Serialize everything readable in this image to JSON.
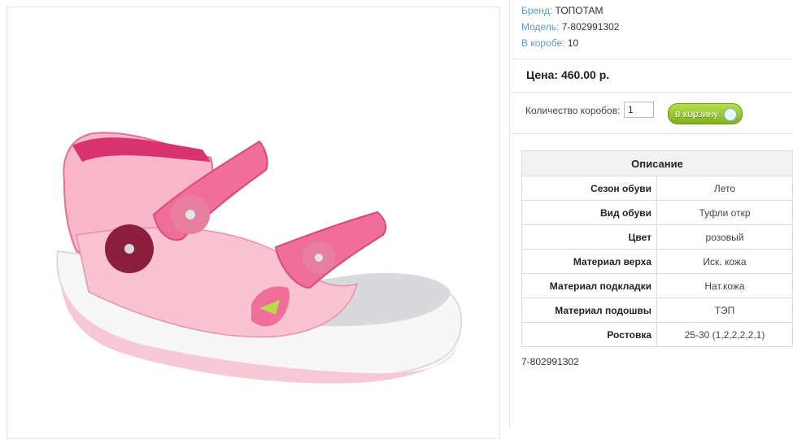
{
  "product": {
    "brand_label": "Бренд:",
    "brand": "ТОПОТАМ",
    "model_label": "Модель:",
    "model": "7-802991302",
    "box_label": "В коробе:",
    "box": "10"
  },
  "price": "Цена: 460.00 р.",
  "order": {
    "qty_label": "Количество коробов:",
    "qty_value": "1",
    "cart_label": "в корзину"
  },
  "description": {
    "header": "Описание",
    "rows": [
      {
        "key": "Сезон обуви",
        "value": "Лето"
      },
      {
        "key": "Вид обуви",
        "value": "Туфли откр"
      },
      {
        "key": "Цвет",
        "value": "розовый"
      },
      {
        "key": "Материал верха",
        "value": "Иск. кожа"
      },
      {
        "key": "Материал подкладки",
        "value": "Нат.кожа"
      },
      {
        "key": "Материал подошвы",
        "value": "ТЭП"
      },
      {
        "key": "Ростовка",
        "value": "25-30 (1,2,2,2,2,1)"
      }
    ]
  },
  "footer_sku": "7-802991302",
  "colors": {
    "link_blue": "#5b9bd1",
    "button_green": "#8cc63f",
    "sandal_pink": "#f06e9a"
  }
}
